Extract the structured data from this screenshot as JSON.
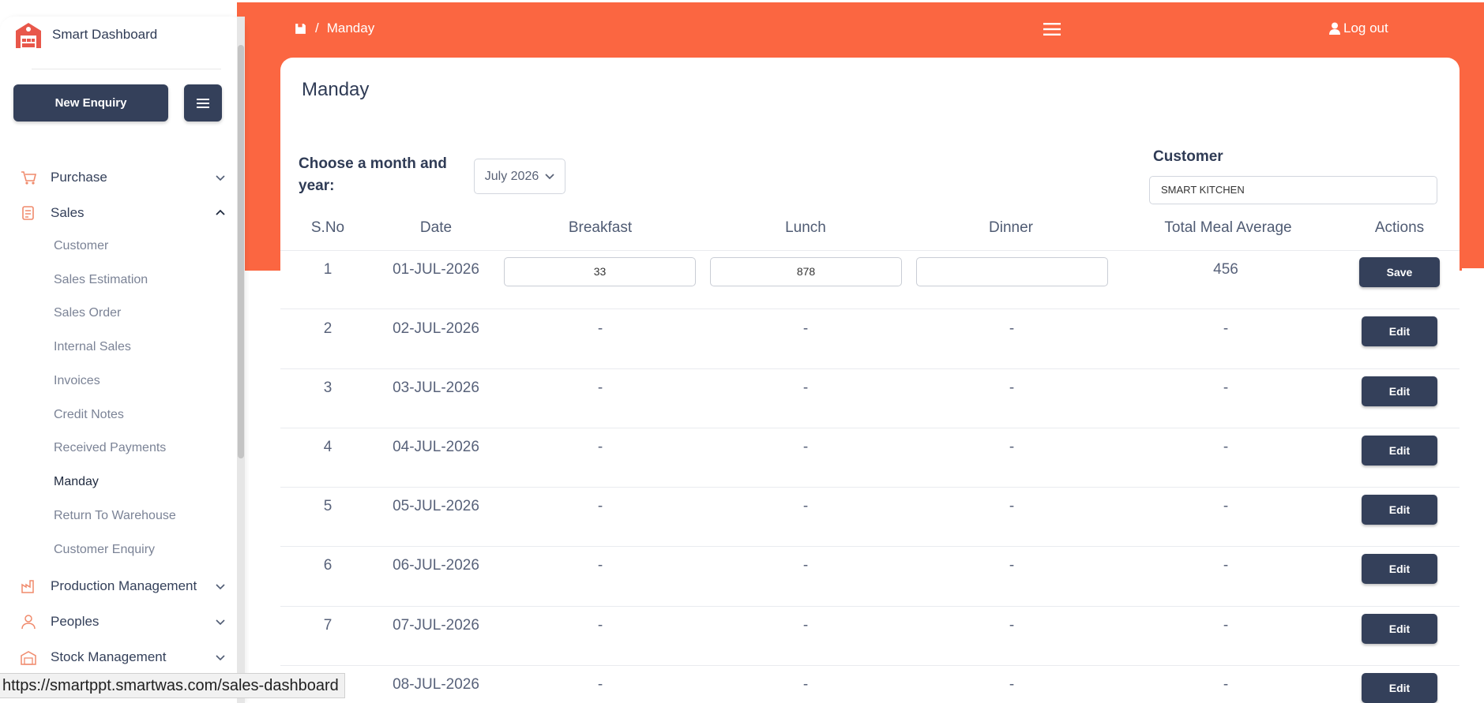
{
  "app": {
    "brand": "Smart Dashboard",
    "new_enquiry": "New Enquiry"
  },
  "sidebar": {
    "items": [
      {
        "label": "Purchase",
        "icon": "cart-icon",
        "expanded": false
      },
      {
        "label": "Sales",
        "icon": "sales-icon",
        "expanded": true
      },
      {
        "label": "Production Management",
        "icon": "production-icon",
        "expanded": false
      },
      {
        "label": "Peoples",
        "icon": "people-icon",
        "expanded": false
      },
      {
        "label": "Stock Management",
        "icon": "stock-icon",
        "expanded": false
      }
    ],
    "sales_sub": [
      "Customer",
      "Sales Estimation",
      "Sales Order",
      "Internal Sales",
      "Invoices",
      "Credit Notes",
      "Received Payments",
      "Manday",
      "Return To Warehouse",
      "Customer Enquiry"
    ],
    "active_sub": "Manday"
  },
  "header": {
    "breadcrumb_sep": "/",
    "breadcrumb_page": "Manday",
    "logout": "Log out"
  },
  "main": {
    "title": "Manday",
    "month_label": "Choose a month and year:",
    "month_value": "July 2026",
    "customer_label": "Customer",
    "customer_value": "SMART KITCHEN"
  },
  "table": {
    "headers": [
      "S.No",
      "Date",
      "Breakfast",
      "Lunch",
      "Dinner",
      "Total Meal Average",
      "Actions"
    ],
    "rows": [
      {
        "sno": "1",
        "date": "01-JUL-2026",
        "breakfast": "33",
        "lunch": "878",
        "dinner": "",
        "avg": "456",
        "action": "Save",
        "editing": true
      },
      {
        "sno": "2",
        "date": "02-JUL-2026",
        "breakfast": "-",
        "lunch": "-",
        "dinner": "-",
        "avg": "-",
        "action": "Edit"
      },
      {
        "sno": "3",
        "date": "03-JUL-2026",
        "breakfast": "-",
        "lunch": "-",
        "dinner": "-",
        "avg": "-",
        "action": "Edit"
      },
      {
        "sno": "4",
        "date": "04-JUL-2026",
        "breakfast": "-",
        "lunch": "-",
        "dinner": "-",
        "avg": "-",
        "action": "Edit"
      },
      {
        "sno": "5",
        "date": "05-JUL-2026",
        "breakfast": "-",
        "lunch": "-",
        "dinner": "-",
        "avg": "-",
        "action": "Edit"
      },
      {
        "sno": "6",
        "date": "06-JUL-2026",
        "breakfast": "-",
        "lunch": "-",
        "dinner": "-",
        "avg": "-",
        "action": "Edit"
      },
      {
        "sno": "7",
        "date": "07-JUL-2026",
        "breakfast": "-",
        "lunch": "-",
        "dinner": "-",
        "avg": "-",
        "action": "Edit"
      },
      {
        "sno": "",
        "date": "08-JUL-2026",
        "breakfast": "-",
        "lunch": "-",
        "dinner": "-",
        "avg": "-",
        "action": "Edit"
      }
    ]
  },
  "status_bar": {
    "url": "https://smartppt.smartwas.com/sales-dashboard"
  },
  "colors": {
    "accent": "#fb6641",
    "primary": "#34405a"
  }
}
